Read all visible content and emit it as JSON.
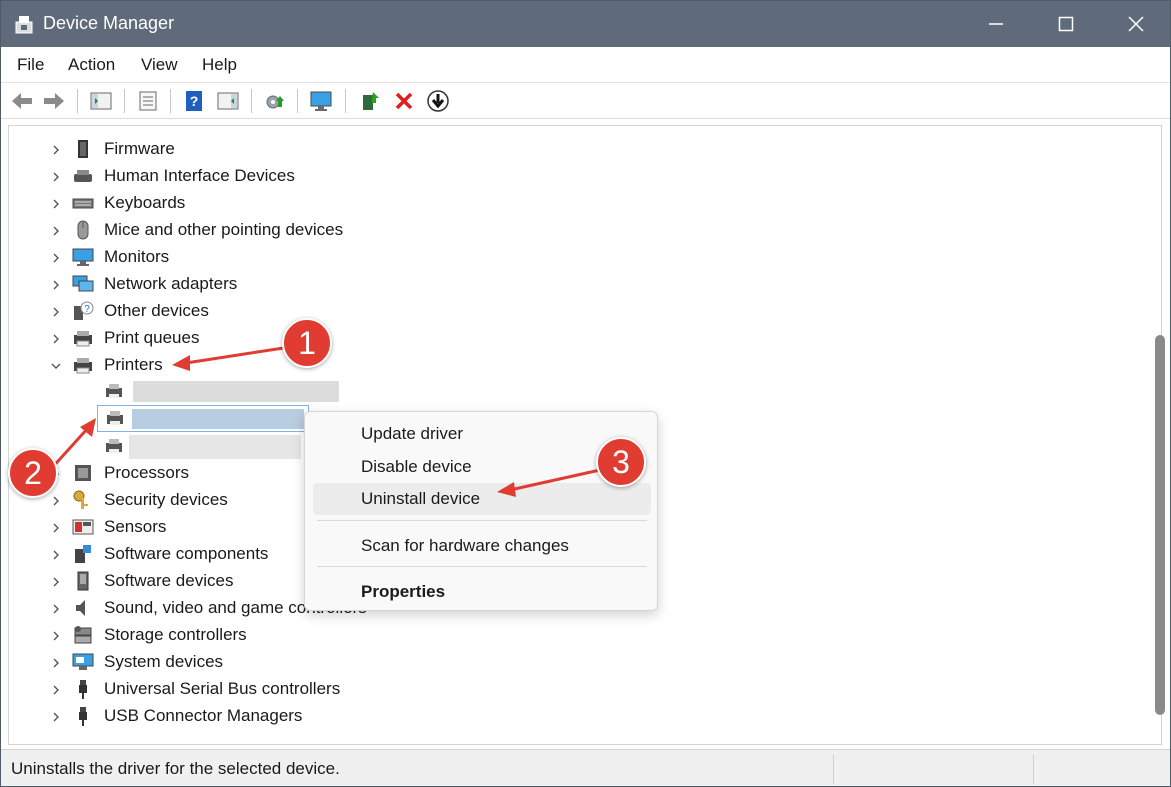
{
  "window": {
    "title": "Device Manager"
  },
  "menubar": {
    "items": [
      "File",
      "Action",
      "View",
      "Help"
    ]
  },
  "tree": {
    "items": [
      {
        "label": "Firmware"
      },
      {
        "label": "Human Interface Devices"
      },
      {
        "label": "Keyboards"
      },
      {
        "label": "Mice and other pointing devices"
      },
      {
        "label": "Monitors"
      },
      {
        "label": "Network adapters"
      },
      {
        "label": "Other devices"
      },
      {
        "label": "Print queues"
      },
      {
        "label": "Printers"
      },
      {
        "label": "Processors"
      },
      {
        "label": "Security devices"
      },
      {
        "label": "Sensors"
      },
      {
        "label": "Software components"
      },
      {
        "label": "Software devices"
      },
      {
        "label": "Sound, video and game controllers"
      },
      {
        "label": "Storage controllers"
      },
      {
        "label": "System devices"
      },
      {
        "label": "Universal Serial Bus controllers"
      },
      {
        "label": "USB Connector Managers"
      }
    ]
  },
  "context_menu": {
    "items": [
      "Update driver",
      "Disable device",
      "Uninstall device",
      "Scan for hardware changes",
      "Properties"
    ]
  },
  "statusbar": {
    "text": "Uninstalls the driver for the selected device."
  },
  "annotations": {
    "callouts": [
      "1",
      "2",
      "3"
    ]
  },
  "colors": {
    "titlebar": "#5f6b7a",
    "callout": "#e03c31",
    "selection": "#cce4f7"
  }
}
